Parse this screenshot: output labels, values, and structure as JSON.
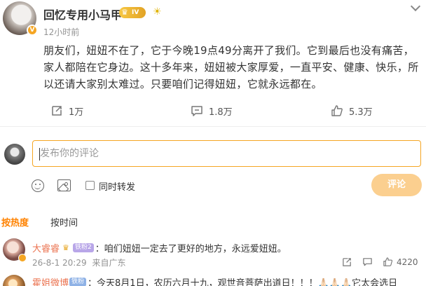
{
  "post": {
    "username": "回忆专用小马甲",
    "level_badge": "IV",
    "timestamp": "12小时前",
    "body": "朋友们，妞妞不在了，它于今晚19点49分离开了我们。它到最后也没有痛苦，家人都陪在它身边。这十多年来，妞妞被大家厚爱，一直平安、健康、快乐，所以还请大家别太难过。只要咱们记得妞妞，它就永远都在。",
    "repost_count": "1万",
    "comment_count": "1.8万",
    "like_count": "5.3万"
  },
  "composer": {
    "placeholder": "发布你的评论",
    "repost_label": "同时转发",
    "submit_label": "评论"
  },
  "sort_tabs": {
    "hot": "按热度",
    "time": "按时间"
  },
  "comments": [
    {
      "name": "大睿睿",
      "fan_badge": "铁粉2",
      "text": "：咱们妞妞一定去了更好的地方，永远爱妞妞。",
      "date": "26-8-1 20:29",
      "location": "来自广东",
      "likes": "4220"
    },
    {
      "name": "霍姐微博",
      "fan_badge": "铁粉",
      "text": "：今天8月1日，农历六月十九，观世音菩萨出道日！！！🙏🏻🙏🏻🙏🏻它太会选日"
    }
  ],
  "colors": {
    "accent": "#ff8200",
    "name": "#eb7350",
    "composer_border": "#f5a623",
    "submit_bg": "#fbcf8f"
  }
}
